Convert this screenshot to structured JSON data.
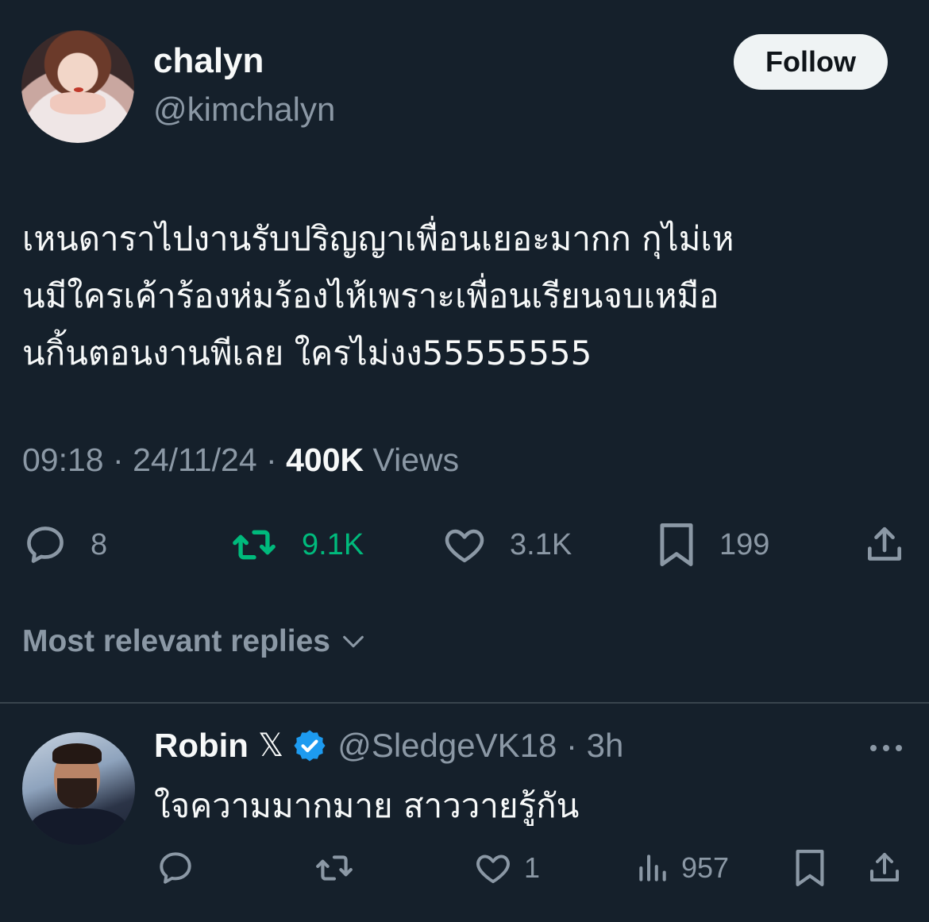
{
  "tweet": {
    "author_name": "chalyn",
    "author_handle": "@kimchalyn",
    "follow_label": "Follow",
    "text_lines": [
      "เหนดาราไปงานรับปริญญาเพื่อนเยอะมากก กุไม่เห",
      "นมีใครเค้าร้องห่มร้องไห้เพราะเพื่อนเรียนจบเหมือ",
      "นกิ้นตอนงานพีเลย ใครไม่งง55555555"
    ],
    "time": "09:18",
    "date": "24/11/24",
    "views_count": "400K",
    "views_label": "Views",
    "separator": "·",
    "stats": {
      "replies": "8",
      "retweets": "9.1K",
      "likes": "3.1K",
      "bookmarks": "199"
    }
  },
  "sort_label": "Most relevant replies",
  "reply": {
    "name": "Robin",
    "x_mark": "𝕏",
    "handle": "@SledgeVK18 · 3h",
    "text": "ใจความมากมาย สาววายรู้กัน",
    "stats": {
      "likes": "1",
      "views": "957"
    }
  },
  "colors": {
    "background": "#15202b",
    "retweet_green": "#00ba7c",
    "verified_blue": "#1d9bf0",
    "muted": "#8b98a5"
  }
}
